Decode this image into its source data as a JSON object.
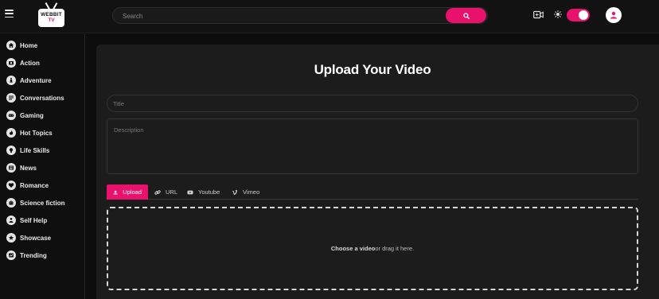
{
  "app": {
    "logo_line1": "WEBBIT",
    "logo_line2": "TV",
    "accent_color": "#e8126c"
  },
  "header": {
    "menu_icon": "hamburger-icon",
    "search": {
      "placeholder": "Search",
      "button_icon": "search-icon"
    },
    "actions": [
      {
        "icon": "video-camera-icon"
      },
      {
        "icon": "sun-icon"
      },
      {
        "icon": "toggle-switch",
        "state": "on"
      },
      {
        "icon": "user-avatar-icon"
      }
    ]
  },
  "sidebar": {
    "items": [
      {
        "label": "Home",
        "icon": "home-icon"
      },
      {
        "label": "Action",
        "icon": "action-icon"
      },
      {
        "label": "Adventure",
        "icon": "adventure-icon"
      },
      {
        "label": "Conversations",
        "icon": "conversations-icon"
      },
      {
        "label": "Gaming",
        "icon": "gamepad-icon"
      },
      {
        "label": "Hot Topics",
        "icon": "fire-icon"
      },
      {
        "label": "Life Skills",
        "icon": "lightbulb-icon"
      },
      {
        "label": "News",
        "icon": "newspaper-icon"
      },
      {
        "label": "Romance",
        "icon": "heart-icon"
      },
      {
        "label": "Science fiction",
        "icon": "robot-icon"
      },
      {
        "label": "Self Help",
        "icon": "self-help-icon"
      },
      {
        "label": "Showcase",
        "icon": "star-icon"
      },
      {
        "label": "Trending",
        "icon": "trending-icon"
      }
    ]
  },
  "main": {
    "title": "Upload Your Video",
    "title_placeholder": "Title",
    "description_placeholder": "Description",
    "tabs": [
      {
        "label": "Upload",
        "icon": "upload-icon",
        "active": true
      },
      {
        "label": "URL",
        "icon": "link-icon",
        "active": false
      },
      {
        "label": "Youtube",
        "icon": "youtube-icon",
        "active": false
      },
      {
        "label": "Vimeo",
        "icon": "vimeo-icon",
        "active": false
      }
    ],
    "dropzone": {
      "strong": "Choose a video",
      "rest": "or drag it here."
    }
  }
}
